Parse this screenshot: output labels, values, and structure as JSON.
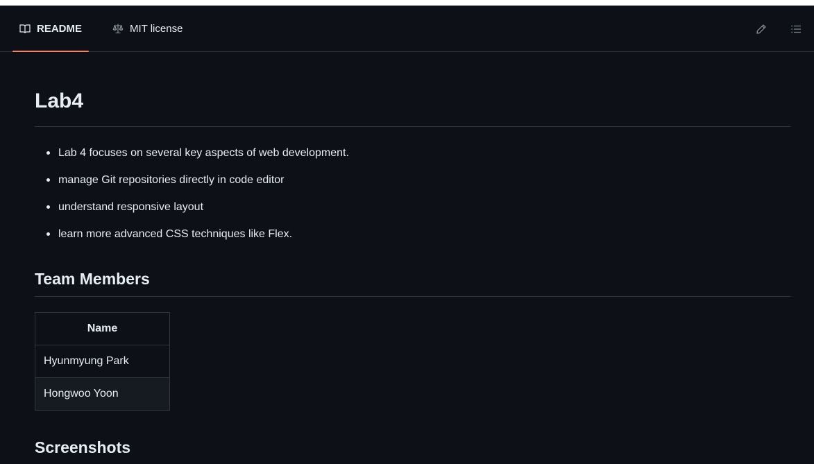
{
  "tabs": {
    "readme_label": "README",
    "license_label": "MIT license"
  },
  "readme": {
    "title": "Lab4",
    "bullets": [
      "Lab 4 focuses on several key aspects of web development.",
      "manage Git repositories directly in code editor",
      "understand responsive layout",
      "learn more advanced CSS techniques like Flex."
    ],
    "team_heading": "Team Members",
    "team_table": {
      "header": "Name",
      "rows": [
        "Hyunmyung Park",
        "Hongwoo Yoon"
      ]
    },
    "screenshots_heading": "Screenshots"
  },
  "icons": {
    "readme": "book-icon",
    "license": "law-scale-icon",
    "edit": "pencil-icon",
    "toc": "list-unordered-icon"
  },
  "colors": {
    "background": "#0d1117",
    "text": "#e6edf3",
    "border": "#30363d",
    "active_tab_underline": "#f78166",
    "muted_icon": "#7d8590"
  }
}
